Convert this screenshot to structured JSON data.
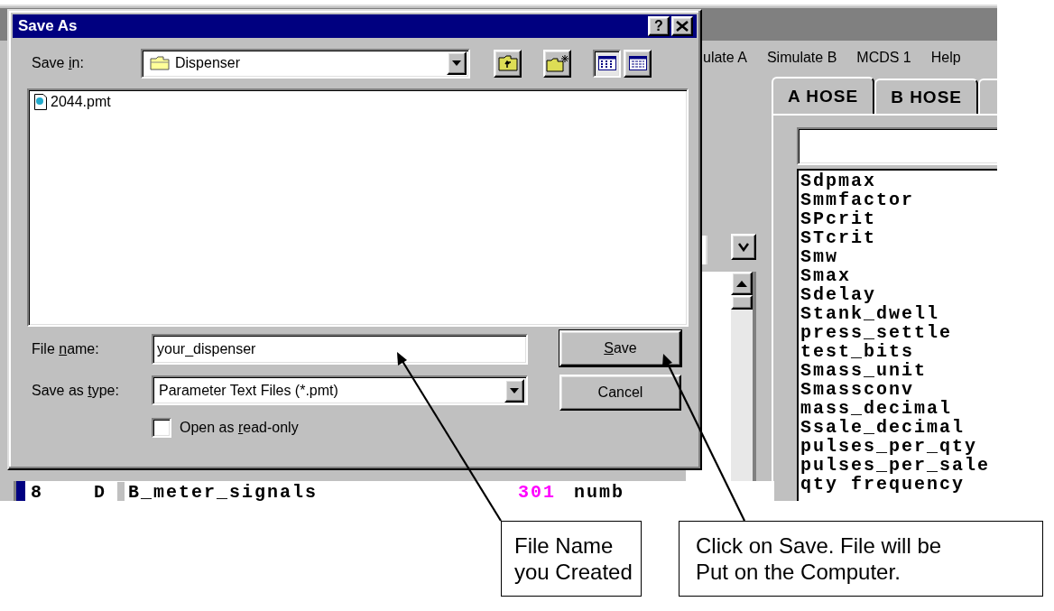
{
  "background_window": {
    "menu": [
      "ulate A",
      "Simulate B",
      "MCDS 1",
      "Help"
    ],
    "tabs": [
      {
        "label": "A HOSE",
        "selected": true
      },
      {
        "label": "B HOSE",
        "selected": false
      }
    ],
    "parameters": [
      "Sdpmax",
      "Smmfactor",
      "SPcrit",
      "STcrit",
      "Smw",
      "Smax",
      "Sdelay",
      "Stank_dwell",
      "press_settle",
      "test_bits",
      "Smass_unit",
      "Smassconv",
      "mass_decimal",
      "Ssale_decimal",
      "pulses_per_qty",
      "pulses_per_sale",
      "qty frequency"
    ],
    "row": {
      "number": "8",
      "type": "D",
      "name": "B_meter_signals",
      "value": "301",
      "unit": "numb"
    }
  },
  "dialog": {
    "title": "Save As",
    "help": "?",
    "save_in": {
      "label": {
        "before": "Save ",
        "key": "i",
        "after": "n:"
      },
      "value": "Dispenser"
    },
    "views": [
      {
        "kind": "list",
        "selected": true
      },
      {
        "kind": "details",
        "selected": false
      }
    ],
    "files": [
      {
        "name": "2044.pmt"
      }
    ],
    "file_name": {
      "label": {
        "before": "File ",
        "key": "n",
        "after": "ame:"
      },
      "value": "your_dispenser"
    },
    "file_type": {
      "label": {
        "before": "Save as ",
        "key": "t",
        "after": "ype:"
      },
      "value": "Parameter Text Files (*.pmt)"
    },
    "read_only": {
      "label": {
        "before": "Open as ",
        "key": "r",
        "after": "ead-only"
      },
      "checked": false
    },
    "buttons": [
      {
        "label": {
          "key": "S",
          "after": "ave"
        },
        "default": true
      },
      {
        "label": {
          "before": "Cancel"
        },
        "default": false
      }
    ]
  },
  "callouts": [
    {
      "lines": [
        "File Name",
        "you Created"
      ]
    },
    {
      "lines": [
        "Click on Save. File will be",
        "Put on the Computer."
      ]
    }
  ]
}
